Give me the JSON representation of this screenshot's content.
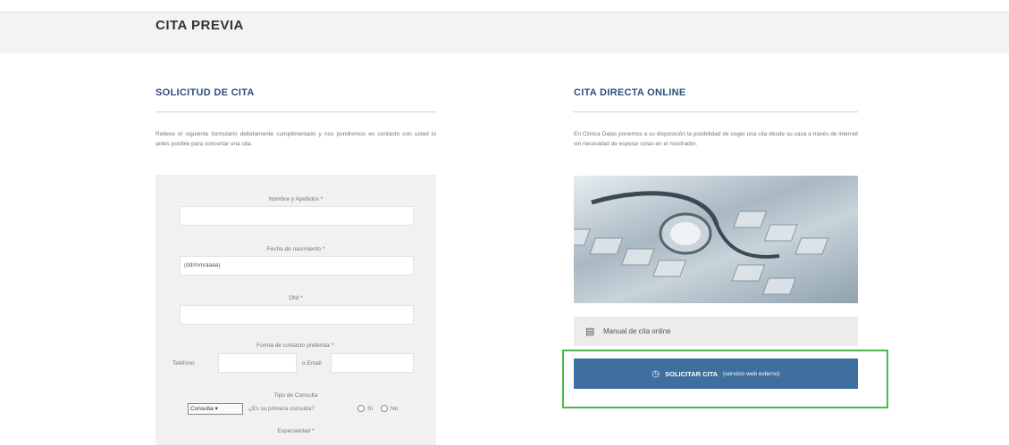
{
  "header": {
    "title": "CITA PREVIA"
  },
  "left": {
    "title": "SOLICITUD DE CITA",
    "intro": "Rellene el siguiente formulario debidamente cumplimentado y nos pondremos en contacto con usted lo antes posible para concertar una cita.",
    "form": {
      "name_label": "Nombre y Apellidos *",
      "dob_label": "Fecha de nacimiento *",
      "dob_placeholder": "(dd/mm/aaaa)",
      "dni_label": "DNI *",
      "contact_label": "Forma de contacto preferida *:",
      "phone_label": "Teléfono",
      "email_label": "o Email",
      "consult_type_label": "Tipo de Consulta",
      "consult_select": "Consulta",
      "first_visit_question": "¿Es su primera consulta?",
      "radio_yes": "Sí",
      "radio_no": "No",
      "specialty_label": "Especialidad *"
    }
  },
  "right": {
    "title": "CITA DIRECTA ONLINE",
    "intro": "En Clínica Dalas ponemos a su disposición la posibilidad de coger una cita desde su casa a través de internet sin necesidad de esperar colas en el mostrador.",
    "manual_text": "Manual de cita online",
    "cta_main": "SOLICITAR CITA",
    "cta_sub": "(servicio web externo)"
  },
  "colors": {
    "accent": "#3f6f9e",
    "title": "#2c4f7c",
    "highlight": "#4cb84c"
  },
  "icons": {
    "manual": "document-icon",
    "cta": "clock-icon",
    "image": "stethoscope-keyboard-image"
  }
}
